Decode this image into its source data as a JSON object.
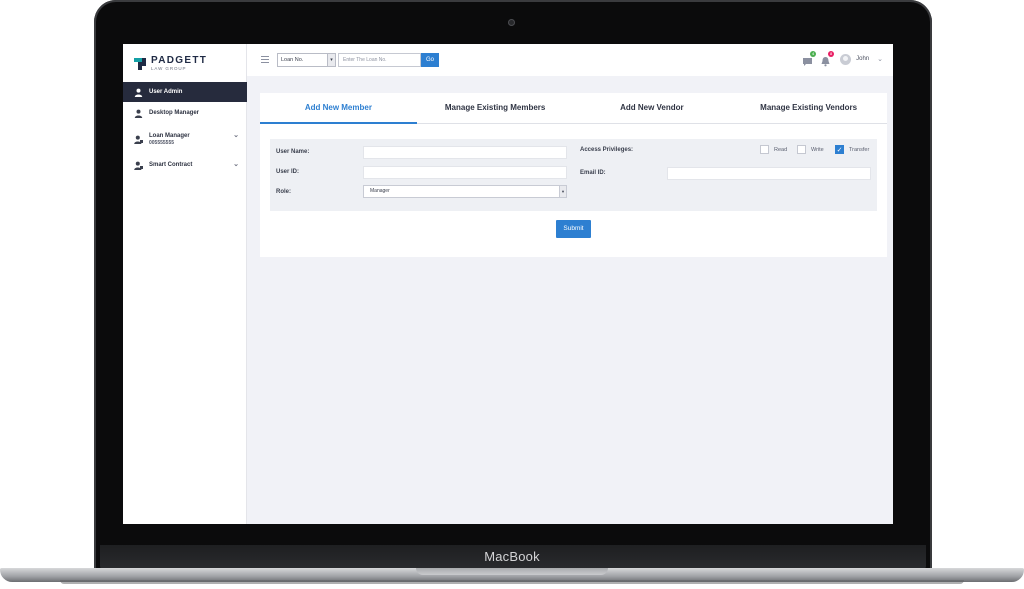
{
  "device": {
    "brand": "MacBook"
  },
  "logo": {
    "title": "PADGETT",
    "subtitle": "LAW GROUP"
  },
  "sidebar": {
    "items": [
      {
        "label": "User Admin",
        "active": true
      },
      {
        "label": "Desktop Manager"
      },
      {
        "label": "Loan Manager",
        "sub": "005555555"
      },
      {
        "label": "Smart Contract"
      }
    ]
  },
  "topbar": {
    "loan_select_value": "Loan No.",
    "loan_input_placeholder": "Enter The Loan No.",
    "go_label": "Go",
    "messages_count": "4",
    "notifications_count": "8",
    "user_name": "John"
  },
  "tabs": [
    {
      "label": "Add New Member",
      "active": true
    },
    {
      "label": "Manage Existing Members"
    },
    {
      "label": "Add New Vendor"
    },
    {
      "label": "Manage Existing Vendors"
    }
  ],
  "form": {
    "user_name_label": "User Name:",
    "user_id_label": "User ID:",
    "role_label": "Role:",
    "role_value": "Manager",
    "access_label": "Access Privileges:",
    "email_label": "Email ID:",
    "privileges": [
      {
        "label": "Read",
        "checked": false
      },
      {
        "label": "Write",
        "checked": false
      },
      {
        "label": "Transfer",
        "checked": true
      }
    ],
    "submit_label": "Submit"
  },
  "colors": {
    "accent": "#2d7fd1",
    "sidebar_active": "#262b3d",
    "badge_green": "#4caf50",
    "badge_pink": "#e91e63"
  }
}
